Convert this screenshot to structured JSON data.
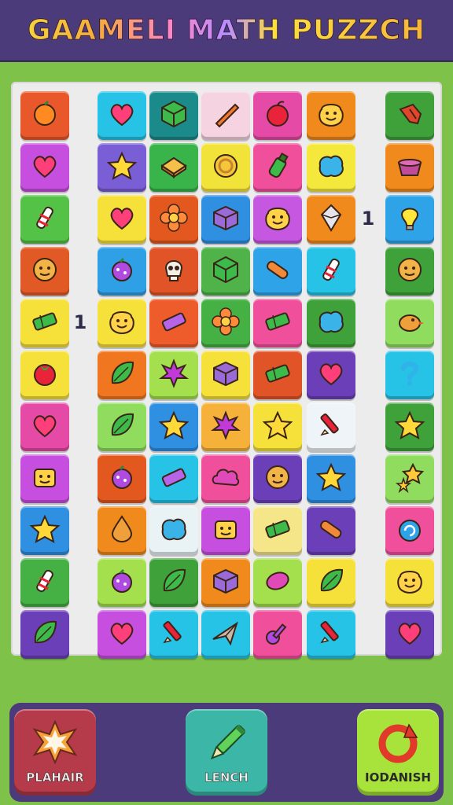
{
  "header": {
    "title": "GAAMELI MATH PUZZCH"
  },
  "board": {
    "row_labels": [
      {
        "text": "1",
        "row": 2,
        "side": "right"
      },
      {
        "text": "1",
        "row": 4,
        "side": "left"
      }
    ],
    "rows": [
      [
        [
          "#e8582b",
          "orange-fruit-icon"
        ],
        [
          "#26c3e6",
          "heart-icon"
        ],
        [
          "#1b8a8a",
          "cube-icon"
        ],
        [
          "#f6d3e0",
          "carrot-icon"
        ],
        [
          "#e54aa6",
          "apple-icon"
        ],
        [
          "#f08a1c",
          "smiley-blob-icon"
        ],
        [
          "#3fa13a",
          "claw-icon"
        ]
      ],
      [
        [
          "#c74fe0",
          "heart-icon"
        ],
        [
          "#7a5ed6",
          "star-icon"
        ],
        [
          "#38b44a",
          "sandwich-icon"
        ],
        [
          "#f2e33a",
          "coin-icon"
        ],
        [
          "#f04f9c",
          "bottle-icon"
        ],
        [
          "#f5e83c",
          "blob-icon"
        ],
        [
          "#f08a1c",
          "pot-icon"
        ]
      ],
      [
        [
          "#54c246",
          "candy-icon"
        ],
        [
          "#f6e13a",
          "heart-icon"
        ],
        [
          "#e2581e",
          "flower-icon"
        ],
        [
          "#2f8fe0",
          "box-icon"
        ],
        [
          "#c657e0",
          "smiley-blob-icon"
        ],
        [
          "#f08a1c",
          "crystal-icon"
        ],
        [
          "#2fa3e8",
          "lightbulb-icon"
        ]
      ],
      [
        [
          "#e15a26",
          "face-icon"
        ],
        [
          "#2f9fe6",
          "berry-icon"
        ],
        [
          "#e05428",
          "skull-icon"
        ],
        [
          "#4fb34a",
          "cube-icon"
        ],
        [
          "#2fa3e8",
          "sausage-icon"
        ],
        [
          "#26c3e6",
          "candy-icon"
        ],
        [
          "#3fa13a",
          "face-icon"
        ]
      ],
      [
        [
          "#f6e13a",
          "bar-icon"
        ],
        [
          "#f6e13a",
          "smiley-blob-icon"
        ],
        [
          "#ee5c2b",
          "eraser-icon"
        ],
        [
          "#45b044",
          "flower-icon"
        ],
        [
          "#f04f9c",
          "bar-icon"
        ],
        [
          "#3fa13a",
          "blob-icon"
        ],
        [
          "#8fdc5e",
          "bird-icon"
        ]
      ],
      [
        [
          "#f6e13a",
          "tomato-icon"
        ],
        [
          "#f0761f",
          "leaf-icon"
        ],
        [
          "#a4e04e",
          "splat-icon"
        ],
        [
          "#f6e13a",
          "box-icon"
        ],
        [
          "#e05428",
          "bar-icon"
        ],
        [
          "#6b3fb8",
          "heart-icon"
        ],
        [
          "#26c3e6",
          "question-icon"
        ]
      ],
      [
        [
          "#e54aa6",
          "heart-icon"
        ],
        [
          "#8fdc5e",
          "leaf-icon"
        ],
        [
          "#2f8fe0",
          "star-icon"
        ],
        [
          "#f5b13a",
          "splat-icon"
        ],
        [
          "#f6e13a",
          "star-icon"
        ],
        [
          "#eef4f7",
          "pencil-icon"
        ],
        [
          "#3fa13a",
          "star-icon"
        ]
      ],
      [
        [
          "#c74fe0",
          "sponge-icon"
        ],
        [
          "#e2581e",
          "berry-icon"
        ],
        [
          "#26c3e6",
          "eraser-icon"
        ],
        [
          "#f04f9c",
          "cloud-icon"
        ],
        [
          "#6b3fb8",
          "face-icon"
        ],
        [
          "#2f8fe0",
          "star-icon"
        ],
        [
          "#8fdc5e",
          "stars-icon"
        ]
      ],
      [
        [
          "#2f8fe0",
          "star-icon"
        ],
        [
          "#f08a1c",
          "drop-icon"
        ],
        [
          "#e9f2f5",
          "blob-icon"
        ],
        [
          "#c74fe0",
          "sponge-icon"
        ],
        [
          "#f6e68a",
          "bar-icon"
        ],
        [
          "#6b3fb8",
          "sausage-icon"
        ],
        [
          "#f04f9c",
          "swirl-icon"
        ]
      ],
      [
        [
          "#45b044",
          "candy-icon"
        ],
        [
          "#a4e04e",
          "berry-icon"
        ],
        [
          "#3fa13a",
          "leaf-icon"
        ],
        [
          "#f08a1c",
          "box-icon"
        ],
        [
          "#a4e04e",
          "lemon-icon"
        ],
        [
          "#f6e13a",
          "leaf-icon"
        ],
        [
          "#f6e13a",
          "smiley-blob-icon"
        ]
      ],
      [
        [
          "#6b3fb8",
          "leaf-icon"
        ],
        [
          "#c74fe0",
          "heart-icon"
        ],
        [
          "#26c3e6",
          "pencil-icon"
        ],
        [
          "#26c3e6",
          "plane-icon"
        ],
        [
          "#f04f9c",
          "guitar-icon"
        ],
        [
          "#26c3e6",
          "pencil-icon"
        ],
        [
          "#6b3fb8",
          "heart-icon"
        ]
      ]
    ]
  },
  "buttons": {
    "left": {
      "label": "PLAHAIR",
      "color": "#b53a4a",
      "icon": "star-burst-icon"
    },
    "middle": {
      "label": "LENCH",
      "color": "#3cb6a6",
      "icon": "pencil-icon"
    },
    "right": {
      "label": "IODANISH",
      "color": "#a7e33a",
      "icon": "refresh-icon"
    }
  }
}
